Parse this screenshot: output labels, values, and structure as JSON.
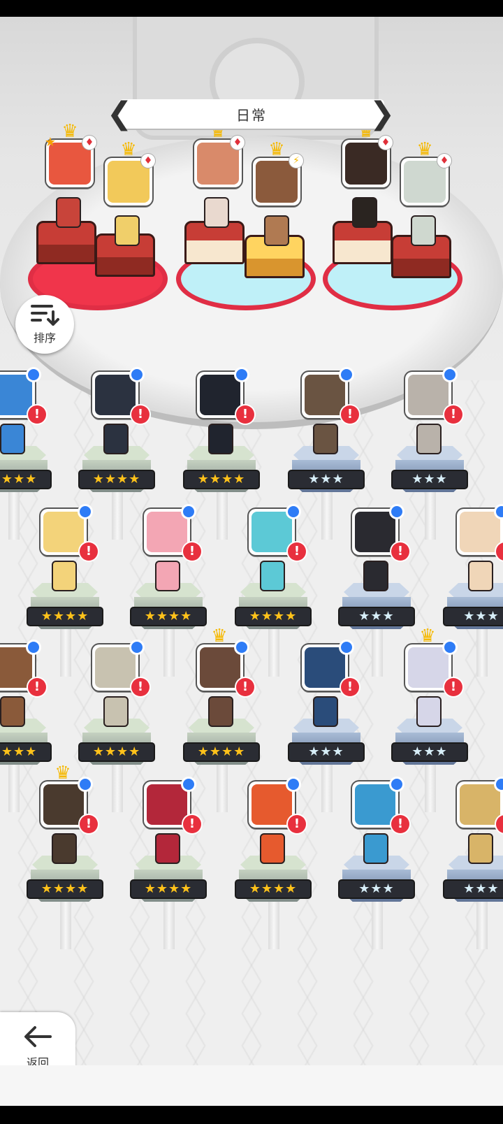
{
  "header": {
    "title": "日常",
    "prev_glyph": "❮",
    "next_glyph": "❯"
  },
  "sort_button": {
    "label": "排序",
    "icon": "sort-list-icon"
  },
  "back_button": {
    "label": "返回",
    "icon": "arrow-left-icon"
  },
  "featured": [
    {
      "id": "hero-1",
      "crown": true,
      "badge": "star",
      "color": "#e8573f"
    },
    {
      "id": "hero-2",
      "crown": true,
      "badge": "diamond",
      "color": "#f2c95a"
    },
    {
      "id": "hero-3",
      "crown": true,
      "badge": "diamond",
      "color": "#d98a6a"
    },
    {
      "id": "hero-4",
      "crown": true,
      "badge": "lightning",
      "color": "#8b5a3c"
    },
    {
      "id": "hero-5",
      "crown": true,
      "badge": "diamond",
      "color": "#3a2a24"
    },
    {
      "id": "hero-6",
      "crown": true,
      "badge": "diamond",
      "color": "#cfd8d0"
    }
  ],
  "glyphs": {
    "crown": "♛",
    "diamond": "♦",
    "star": "★",
    "lightning": "⚡",
    "alert": "!"
  },
  "roster": [
    {
      "row": 1,
      "stars": "★★★★",
      "tier": "gold",
      "color": "#3a86d6",
      "partial": true
    },
    {
      "row": 1,
      "stars": "★★★★",
      "tier": "gold",
      "color": "#2b3240"
    },
    {
      "row": 1,
      "stars": "★★★★",
      "tier": "gold",
      "color": "#20242e"
    },
    {
      "row": 1,
      "stars": "★★★",
      "tier": "silver",
      "color": "#6a5442"
    },
    {
      "row": 1,
      "stars": "★★★",
      "tier": "silver",
      "color": "#b9b2aa"
    },
    {
      "row": 2,
      "stars": "★★★★",
      "tier": "gold",
      "color": "#f3d37a"
    },
    {
      "row": 2,
      "stars": "★★★★",
      "tier": "gold",
      "color": "#f3a6b4"
    },
    {
      "row": 2,
      "stars": "★★★★",
      "tier": "gold",
      "color": "#5cc9d6"
    },
    {
      "row": 2,
      "stars": "★★★",
      "tier": "silver",
      "color": "#2a2a30"
    },
    {
      "row": 2,
      "stars": "★★★",
      "tier": "silver",
      "color": "#f0d6b8",
      "partial": true
    },
    {
      "row": 3,
      "stars": "★★★★",
      "tier": "gold",
      "color": "#8a5a3a",
      "partial": true
    },
    {
      "row": 3,
      "stars": "★★★★",
      "tier": "gold",
      "color": "#c8c2b0"
    },
    {
      "row": 3,
      "stars": "★★★★",
      "tier": "gold",
      "color": "#6b4a3a",
      "crown": true
    },
    {
      "row": 3,
      "stars": "★★★",
      "tier": "silver",
      "color": "#2a4c7a"
    },
    {
      "row": 3,
      "stars": "★★★",
      "tier": "silver",
      "color": "#d6d6e8",
      "crown": true
    },
    {
      "row": 4,
      "stars": "★★★★",
      "tier": "gold",
      "color": "#4a3a2e",
      "crown": true
    },
    {
      "row": 4,
      "stars": "★★★★",
      "tier": "gold",
      "color": "#b3273a"
    },
    {
      "row": 4,
      "stars": "★★★★",
      "tier": "gold",
      "color": "#e65a2e"
    },
    {
      "row": 4,
      "stars": "★★★",
      "tier": "silver",
      "color": "#3a9ad0"
    },
    {
      "row": 4,
      "stars": "★★★",
      "tier": "silver",
      "color": "#d8b468",
      "partial": true
    }
  ]
}
